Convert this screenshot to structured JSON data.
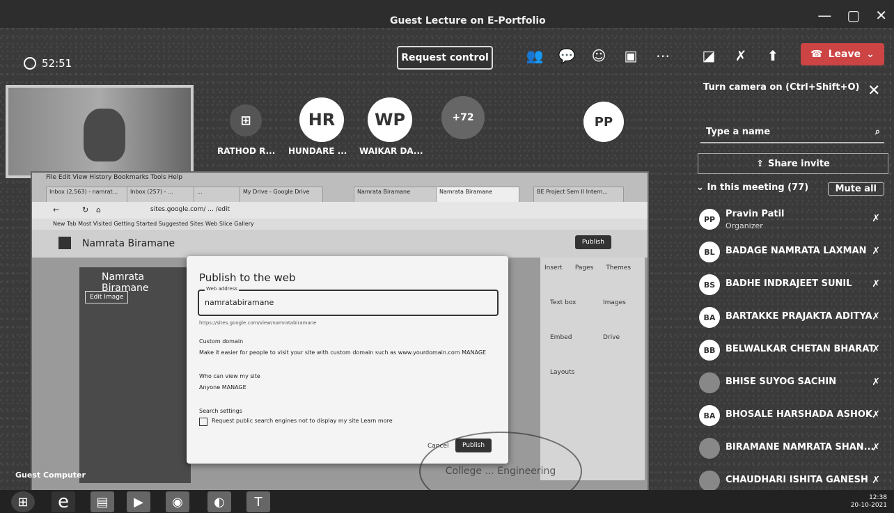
{
  "window": {
    "title": "Guest Lecture on E-Portfolio"
  },
  "toolbar": {
    "timer": "52:51",
    "request_control": "Request control",
    "leave_label": "Leave",
    "tooltip": "Turn camera on (Ctrl+Shift+O)"
  },
  "stage": {
    "participants": [
      {
        "initials": "",
        "name": "RATHOD R..."
      },
      {
        "initials": "HR",
        "name": "HUNDARE ..."
      },
      {
        "initials": "WP",
        "name": "WAIKAR DA..."
      },
      {
        "initials": "+72",
        "name": ""
      },
      {
        "initials": "PP",
        "name": ""
      }
    ]
  },
  "panel": {
    "search_placeholder": "Type a name",
    "share_invite": "Share invite",
    "in_meeting": "In this meeting (77)",
    "mute_all": "Mute all",
    "people": [
      {
        "initials": "PP",
        "name": "Pravin Patil",
        "role": "Organizer"
      },
      {
        "initials": "BL",
        "name": "BADAGE NAMRATA LAXMAN",
        "role": ""
      },
      {
        "initials": "BS",
        "name": "BADHE INDRAJEET SUNIL",
        "role": ""
      },
      {
        "initials": "BA",
        "name": "BARTAKKE PRAJAKTA ADITYA",
        "role": ""
      },
      {
        "initials": "BB",
        "name": "BELWALKAR CHETAN BHARAT",
        "role": ""
      },
      {
        "initials": "",
        "name": "BHISE SUYOG SACHIN",
        "role": ""
      },
      {
        "initials": "BA",
        "name": "BHOSALE HARSHADA ASHOK",
        "role": ""
      },
      {
        "initials": "",
        "name": "BIRAMANE NAMRATA SHAN...",
        "role": ""
      },
      {
        "initials": "",
        "name": "CHAUDHARI ISHITA GANESH",
        "role": ""
      }
    ]
  },
  "shared": {
    "menubar": "File  Edit  View  History  Bookmarks  Tools  Help",
    "tabs": [
      "Inbox (2,563) - namrat...",
      "Inbox (257) - ...",
      "...",
      "My Drive - Google Drive",
      "Namrata Biramane",
      "Namrata Biramane",
      "BE Project Sem II Intern..."
    ],
    "url": "sites.google.com/ ... /edit",
    "bookmarks": "New Tab   Most Visited   Getting Started   Suggested Sites   Web Slice Gallery",
    "site_title": "Namrata Biramane",
    "publish_btn": "Publish",
    "left_title": "Namrata Biramane",
    "left_btn": "Edit Image",
    "right_tabs": [
      "Insert",
      "Pages",
      "Themes"
    ],
    "right_items": [
      "Text box",
      "Images",
      "Embed",
      "Drive",
      "Layouts"
    ],
    "dialog": {
      "title": "Publish to the web",
      "field_label": "Web address",
      "field_value": "namratabiramane",
      "hint": "https://sites.google.com/view/namratabiramane",
      "custom_domain": "Custom domain",
      "custom_desc": "Make it easier for people to visit your site with custom domain such as www.yourdomain.com    MANAGE",
      "who_view": "Who can view my site",
      "who_desc": "Anyone  MANAGE",
      "search_settings": "Search settings",
      "search_desc": "Request public search engines not to display my site   Learn more",
      "cancel": "Cancel",
      "publish": "Publish"
    },
    "stamp": "College ... Engineering"
  },
  "guest_label": "Guest Computer",
  "clock": {
    "time": "12:38",
    "date": "20-10-2021"
  }
}
